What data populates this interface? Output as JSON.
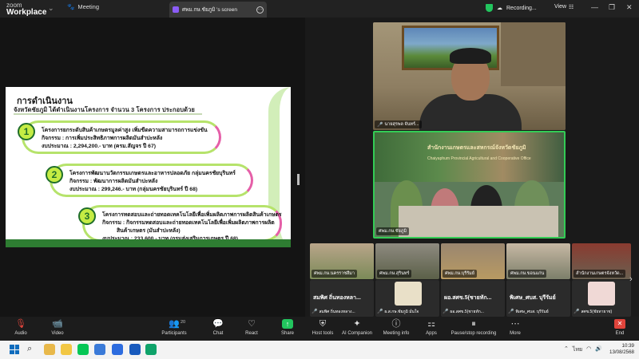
{
  "app": {
    "brand_line1": "zoom",
    "brand_line2": "Workplace",
    "meeting_tab": "Meeting",
    "screen_tab": "ศพม.กษ.ชัยภูมิ 's screen",
    "recording": "Recording...",
    "view": "View"
  },
  "slide": {
    "title": "การดำเนินงาน",
    "subtitle": "จังหวัดชัยภูมิ ได้ดำเนินงานโครงการ จำนวน 3 โครงการ ประกอบด้วย",
    "items": [
      {
        "num": "1",
        "lines": [
          "โครงการยกระดับสินค้าเกษตรมูลค่าสูง เพิ่มขีดความสามารถการแข่งขัน",
          "กิจกรรม : การเพิ่มประสิทธิภาพการผลิตมันสำปะหลัง",
          "งบประมาณ : 2,294,200.- บาท (ครม.สัญจร ปี 67)"
        ]
      },
      {
        "num": "2",
        "lines": [
          "โครงการพัฒนานวัตกรรมเกษตรและอาหารปลอดภัย กลุ่มนครชัยบุรินทร์",
          "กิจกรรม : พัฒนาการผลิตมันสำปะหลัง",
          "งบประมาณ : 299,246.- บาท (กลุ่มนครชัยบุรินทร์ ปี 68)"
        ]
      },
      {
        "num": "3",
        "lines": [
          "โครงการทดสอบและถ่ายทอดเทคโนโลยีเพื่อเพิ่มผลิตภาพการผลิตสินค้าเกษตร",
          "กิจกรรม : กิจกรรมทดสอบและถ่ายทอดเทคโนโลยีเพื่อเพิ่มผลิตภาพการผลิต",
          "สินค้าเกษตร (มันสำปะหลัง)",
          "งบประมาณ : 233,600.- บาท (กรมส่งเสริมการเกษตร ปี 68)"
        ]
      }
    ]
  },
  "videos": {
    "main1_name": "นายสุรพล จันทร์...",
    "main2_name": "ศพม.กษ.ชัยภูมิ",
    "banner_th": "สำนักงานเกษตรและสหกรณ์จังหวัดชัยภูมิ",
    "banner_en": "Chaiyaphum Provincial Agricultural and Cooperative Office",
    "strip": [
      {
        "name": "ศพม.กษ.นครราชสีมา"
      },
      {
        "name": "ศพม.กษ.สุรินทร์"
      },
      {
        "name": "ศพม.กษ.บุรีรัมย์"
      },
      {
        "name": "ศพม.กษ.ขอนแก่น"
      },
      {
        "name": "สำนักงานเกษตรจังหวัด..."
      }
    ],
    "tiles": [
      {
        "name": "สมพิศ ถิ่นทองหลา...",
        "sub": "สมพิศ ถิ่นทองหลาง..."
      },
      {
        "name": "",
        "sub": "ผ.ส.กษ.ชัยภูมิ มั่นใจ"
      },
      {
        "name": "ผอ.สศข.5(ชายทัก...",
        "sub": "ผอ.สศข.5(ชายทัก..."
      },
      {
        "name": "พิเศษ_ศบส. บุรีรัมย์",
        "sub": "พิเศษ_ศบส. บุรีรัมย์"
      },
      {
        "name": "",
        "sub": "สศข.5(ชัยทายาช)"
      }
    ]
  },
  "toolbar": {
    "audio": "Audio",
    "video": "Video",
    "participants": "Participants",
    "participants_count": "20",
    "chat": "Chat",
    "react": "React",
    "share": "Share",
    "host_tools": "Host tools",
    "ai_companion": "AI Companion",
    "meeting_info": "Meeting info",
    "apps": "Apps",
    "pause_recording": "Pause/stop recording",
    "more": "More",
    "end": "End"
  },
  "taskbar": {
    "lang": "ไทย",
    "time": "10:39",
    "date": "13/08/2568"
  },
  "colors": {
    "active_speaker": "#33cc55",
    "recording_shield": "#22c55e",
    "end_button": "#e0443b"
  }
}
